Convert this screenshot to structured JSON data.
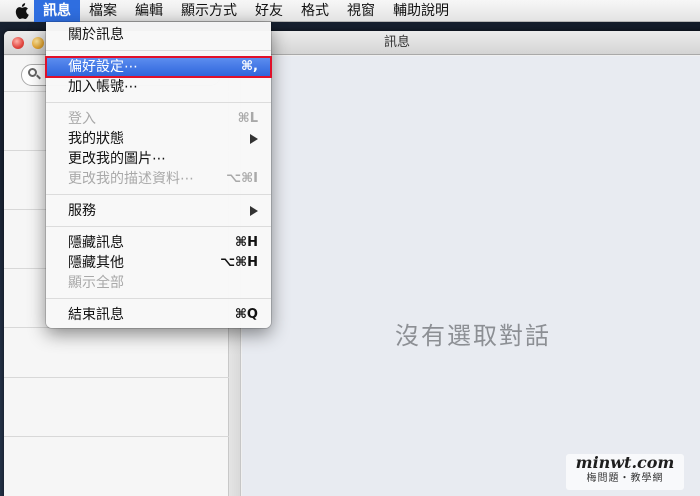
{
  "menubar": {
    "apple_icon": "apple-logo-icon",
    "items": [
      "訊息",
      "檔案",
      "編輯",
      "顯示方式",
      "好友",
      "格式",
      "視窗",
      "輔助說明"
    ]
  },
  "window": {
    "title": "訊息",
    "no_conversation_text": "沒有選取對話"
  },
  "dropdown": {
    "about": {
      "label": "關於訊息"
    },
    "preferences": {
      "label": "偏好設定⋯",
      "shortcut": "⌘,"
    },
    "add_account": {
      "label": "加入帳號⋯"
    },
    "login": {
      "label": "登入",
      "shortcut": "⌘L"
    },
    "my_status": {
      "label": "我的狀態"
    },
    "change_picture": {
      "label": "更改我的圖片⋯"
    },
    "change_description": {
      "label": "更改我的描述資料⋯",
      "shortcut": "⌥⌘I"
    },
    "services": {
      "label": "服務"
    },
    "hide_messages": {
      "label": "隱藏訊息",
      "shortcut": "⌘H"
    },
    "hide_others": {
      "label": "隱藏其他",
      "shortcut": "⌥⌘H"
    },
    "show_all": {
      "label": "顯示全部"
    },
    "quit": {
      "label": "結束訊息",
      "shortcut": "⌘Q"
    }
  },
  "colors": {
    "highlight": "#2c63db",
    "annotation_box": "#e0102a"
  },
  "watermark": {
    "domain": "minwt.com",
    "tagline": "梅問題・教學網"
  }
}
